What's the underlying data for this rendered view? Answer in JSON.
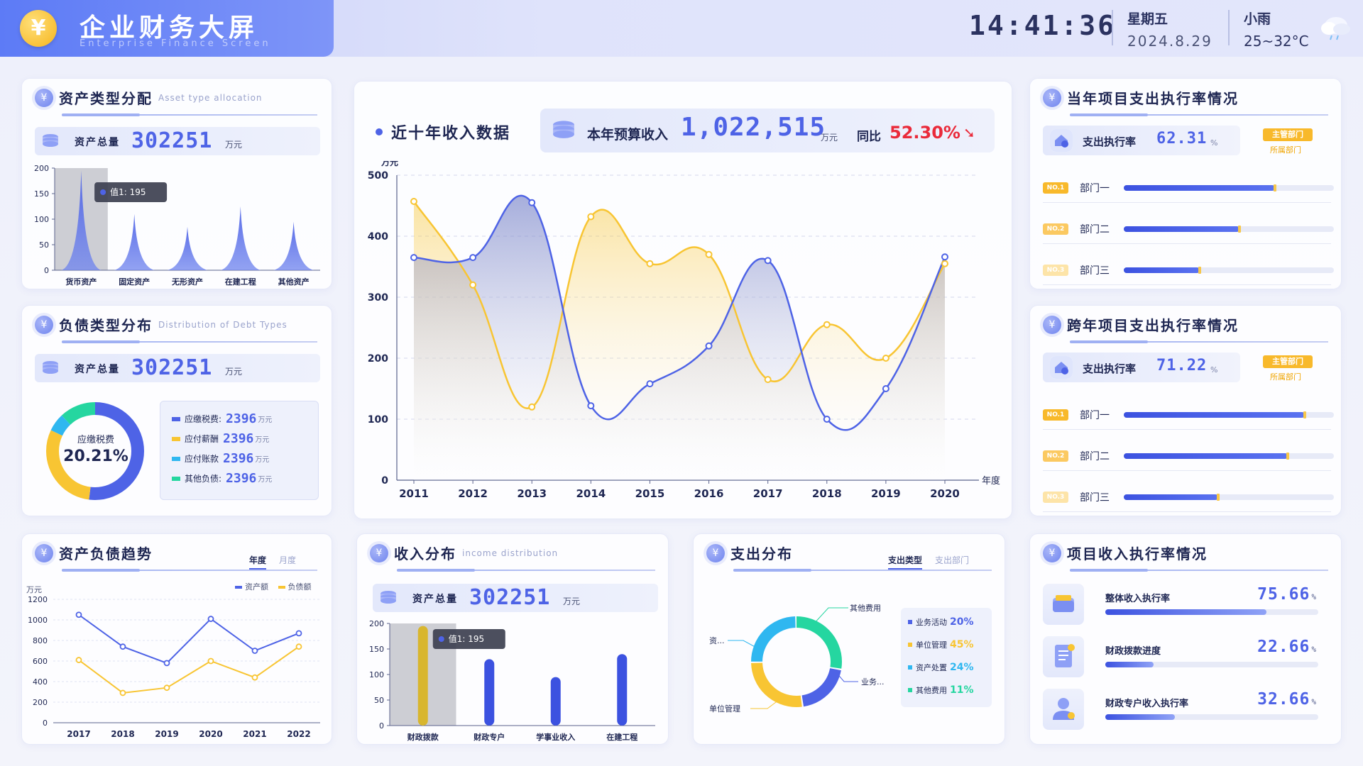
{
  "header": {
    "title": "企业财务大屏",
    "subtitle": "Enterprise Finance Screen",
    "time": "14:41:36",
    "weekday": "星期五",
    "date": "2024.8.29",
    "weather": "小雨",
    "temperature": "25~32°C"
  },
  "colors": {
    "primary": "#4e63e6",
    "accent": "#f8c533",
    "cyan": "#2fb7f0",
    "green": "#25d6a0",
    "red": "#ea2a3a"
  },
  "asset_alloc": {
    "title": "资产类型分配",
    "title_en": "Asset type allocation",
    "total_label": "资产总量",
    "total_value": "302251",
    "unit": "万元",
    "tooltip": "值1:  195"
  },
  "debt_types": {
    "title": "负债类型分布",
    "title_en": "Distribution of Debt Types",
    "total_label": "资产总量",
    "total_value": "302251",
    "unit": "万元",
    "donut_label": "应缴税费",
    "donut_value": "20.21%",
    "legend": [
      {
        "label": "应缴税费:",
        "value": "2396",
        "unit": "万元",
        "color": "#4e63e6"
      },
      {
        "label": "应付薪酬",
        "value": "2396",
        "unit": "万元",
        "color": "#f8c533"
      },
      {
        "label": "应付账款",
        "value": "2396",
        "unit": "万元",
        "color": "#2fb7f0"
      },
      {
        "label": "其他负债:",
        "value": "2396",
        "unit": "万元",
        "color": "#25d6a0"
      }
    ]
  },
  "trend": {
    "title": "资产负债趋势",
    "tab_year": "年度",
    "tab_month": "月度",
    "unit": "万元",
    "legend_a": "资产额",
    "legend_b": "负债额"
  },
  "income_dist": {
    "title": "收入分布",
    "title_en": "income distribution",
    "total_label": "资产总量",
    "total_value": "302251",
    "unit": "万元",
    "tooltip": "值1:  195"
  },
  "expense_dist": {
    "title": "支出分布",
    "tab_type": "支出类型",
    "tab_dept": "支出部门",
    "callouts": [
      "其他费用",
      "资...",
      "业务...",
      "单位管理"
    ],
    "legend": [
      {
        "label": "业务活动",
        "value": "20%",
        "color": "#4e63e6"
      },
      {
        "label": "单位管理",
        "value": "45%",
        "color": "#f8c533"
      },
      {
        "label": "资产处置",
        "value": "24%",
        "color": "#2fb7f0"
      },
      {
        "label": "其他费用",
        "value": "11%",
        "color": "#25d6a0"
      }
    ]
  },
  "main": {
    "title": "近十年收入数据",
    "budget_label": "本年预算收入",
    "budget_value": "1,022,515",
    "budget_unit": "万元",
    "yoy_label": "同比",
    "yoy_value": "52.30%",
    "ylabel": "万元",
    "xlabel": "年度"
  },
  "cur_project": {
    "title": "当年项目支出执行率情况",
    "rate_label": "支出执行率",
    "rate_value": "62.31",
    "rate_unit": "%",
    "tag": "主管部门",
    "tag_sub": "所属部门",
    "depts": [
      {
        "no": "NO.1",
        "name": "部门一",
        "pct": 0.72,
        "color": "#f8b92b"
      },
      {
        "no": "NO.2",
        "name": "部门二",
        "pct": 0.55,
        "color": "#fbc961"
      },
      {
        "no": "NO.3",
        "name": "部门三",
        "pct": 0.36,
        "color": "#fde4a8"
      }
    ]
  },
  "cross_project": {
    "title": "跨年项目支出执行率情况",
    "rate_label": "支出执行率",
    "rate_value": "71.22",
    "rate_unit": "%",
    "tag": "主管部门",
    "tag_sub": "所属部门",
    "depts": [
      {
        "no": "NO.1",
        "name": "部门一",
        "pct": 0.86,
        "color": "#f8b92b"
      },
      {
        "no": "NO.2",
        "name": "部门二",
        "pct": 0.78,
        "color": "#fbc961"
      },
      {
        "no": "NO.3",
        "name": "部门三",
        "pct": 0.45,
        "color": "#fde4a8"
      }
    ]
  },
  "project_income": {
    "title": "项目收入执行率情况",
    "rows": [
      {
        "label": "整体收入执行率",
        "value": "75.66",
        "unit": "%",
        "pct": 0.7566,
        "icon": "wallet-icon"
      },
      {
        "label": "财政拨款进度",
        "value": "22.66",
        "unit": "%",
        "pct": 0.2266,
        "icon": "document-icon"
      },
      {
        "label": "财政专户收入执行率",
        "value": "32.66",
        "unit": "%",
        "pct": 0.3266,
        "icon": "user-icon"
      }
    ]
  },
  "chart_data": [
    {
      "id": "main",
      "type": "area",
      "x": [
        "2011",
        "2012",
        "2013",
        "2014",
        "2015",
        "2016",
        "2017",
        "2018",
        "2019",
        "2020"
      ],
      "series": [
        {
          "values": [
            365,
            365,
            455,
            122,
            158,
            220,
            360,
            100,
            150,
            366
          ],
          "color": "#4e63e6"
        },
        {
          "values": [
            457,
            320,
            120,
            432,
            355,
            370,
            165,
            255,
            200,
            355
          ],
          "color": "#f8c533"
        }
      ],
      "ylabel": "万元",
      "xlabel": "年度",
      "ylim": [
        0,
        500
      ],
      "yticks": [
        0,
        100,
        200,
        300,
        400,
        500
      ],
      "grid": true
    },
    {
      "id": "asset_alloc",
      "type": "area",
      "categories": [
        "货币资产",
        "固定资产",
        "无形资产",
        "在建工程",
        "其他资产"
      ],
      "values": [
        195,
        110,
        85,
        125,
        95
      ],
      "ylim": [
        0,
        200
      ],
      "yticks": [
        0,
        50,
        100,
        150,
        200
      ],
      "highlight_index": 0
    },
    {
      "id": "trend",
      "type": "line",
      "x": [
        "2017",
        "2018",
        "2019",
        "2020",
        "2021",
        "2022"
      ],
      "series": [
        {
          "name": "资产额",
          "values": [
            1050,
            740,
            580,
            1010,
            700,
            870
          ],
          "color": "#4e63e6"
        },
        {
          "name": "负债额",
          "values": [
            610,
            290,
            340,
            600,
            440,
            740
          ],
          "color": "#f8c533"
        }
      ],
      "ylabel": "万元",
      "ylim": [
        0,
        1200
      ],
      "yticks": [
        0,
        200,
        400,
        600,
        800,
        1000,
        1200
      ]
    },
    {
      "id": "income_dist",
      "type": "bar",
      "categories": [
        "财政拨款",
        "财政专户",
        "学事业收入",
        "在建工程"
      ],
      "values": [
        195,
        130,
        95,
        140
      ],
      "ylim": [
        0,
        200
      ],
      "yticks": [
        0,
        50,
        100,
        150,
        200
      ],
      "highlight_index": 0
    },
    {
      "id": "expense_dist",
      "type": "pie",
      "categories": [
        "其他费用",
        "业务活动",
        "单位管理",
        "资产处置"
      ],
      "values": [
        28,
        20,
        27,
        25
      ]
    },
    {
      "id": "debt_types",
      "type": "pie",
      "categories": [
        "应缴税费",
        "应付薪酬",
        "应付账款",
        "其他负债"
      ],
      "values": [
        52,
        30,
        6,
        12
      ]
    }
  ]
}
